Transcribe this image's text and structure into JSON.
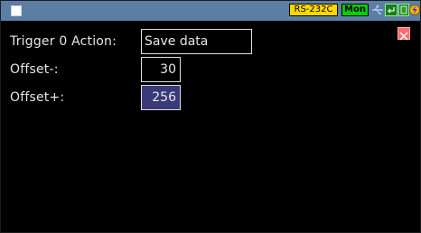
{
  "status_bar": {
    "interface_badge": "RS-232C",
    "mode_badge": "Mon",
    "icons": [
      "menu-square-icon",
      "usb-icon",
      "enter-arrow-icon",
      "storage-icon",
      "power-plug-icon"
    ],
    "colors": {
      "bar": "#5d7ea4",
      "interface_badge": "#ffd800",
      "mode_badge": "#00d000"
    }
  },
  "form": {
    "trigger_label": "Trigger 0 Action:",
    "trigger_value": "Save data",
    "offset_minus_label": "Offset-:",
    "offset_minus_value": "30",
    "offset_plus_label": "Offset+:",
    "offset_plus_value": "256"
  },
  "close_icon": "close-icon",
  "colors": {
    "selected_field": "#3a3a78",
    "close_button": "#ff6b6b"
  }
}
